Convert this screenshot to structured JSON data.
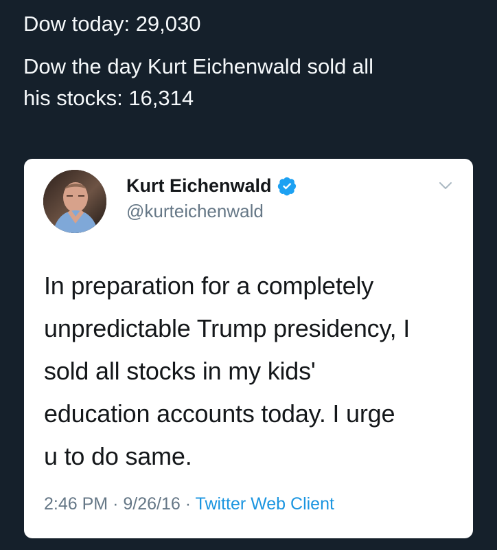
{
  "outer_post": {
    "line1": "Dow today: 29,030",
    "line2a": "Dow the day Kurt Eichenwald sold all",
    "line2b": "his stocks: 16,314"
  },
  "tweet": {
    "author_name": "Kurt Eichenwald",
    "handle": "@kurteichenwald",
    "verified_icon": "verified-badge-icon",
    "menu_icon": "chevron-down-icon",
    "body_lines": [
      "In preparation for a completely",
      "unpredictable Trump presidency, I",
      "sold all stocks in my kids'",
      "education accounts today. I urge",
      "u to do same."
    ],
    "time": "2:46 PM",
    "separator": "·",
    "date": "9/26/16",
    "source": "Twitter Web Client"
  },
  "colors": {
    "background": "#15202b",
    "card": "#ffffff",
    "accent": "#1b95e0",
    "muted": "#657786"
  }
}
